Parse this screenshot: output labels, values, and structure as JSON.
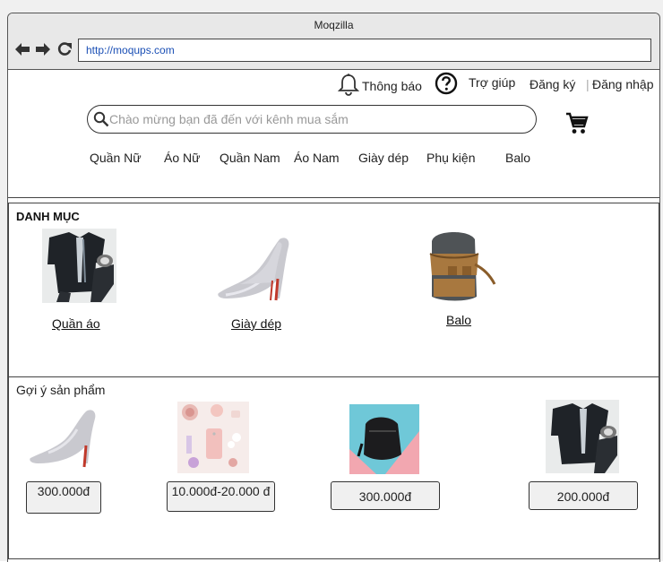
{
  "browser": {
    "title": "Moqzilla",
    "url": "http://moqups.com"
  },
  "header": {
    "notifications_label": "Thông báo",
    "help_label": "Trợ giúp",
    "register_label": "Đăng ký",
    "separator": "|",
    "login_label": "Đăng nhập"
  },
  "search": {
    "placeholder": "Chào mừng bạn đã đến với kênh mua sắm"
  },
  "menu": {
    "items": [
      "Quần Nữ",
      "Áo Nữ",
      "Quần Nam",
      "Áo Nam",
      "Giày dép",
      "Phụ kiện",
      "Balo"
    ]
  },
  "categories": {
    "heading": "DANH MỤC",
    "items": [
      {
        "label": "Quần áo",
        "image": "clothes"
      },
      {
        "label": "Giày dép",
        "image": "high-heels"
      },
      {
        "label": "Balo",
        "image": "backpack"
      }
    ]
  },
  "suggestions": {
    "heading": "Gợi ý sản phẩm",
    "items": [
      {
        "image": "high-heels",
        "price": "300.000đ"
      },
      {
        "image": "cosmetics",
        "price": "10.000đ-20.000 đ"
      },
      {
        "image": "black-backpack",
        "price": "300.000đ"
      },
      {
        "image": "clothes",
        "price": "200.000đ"
      }
    ]
  },
  "colors": {
    "url_text": "#1a4fb5",
    "titlebar": "#e8e8e8"
  }
}
